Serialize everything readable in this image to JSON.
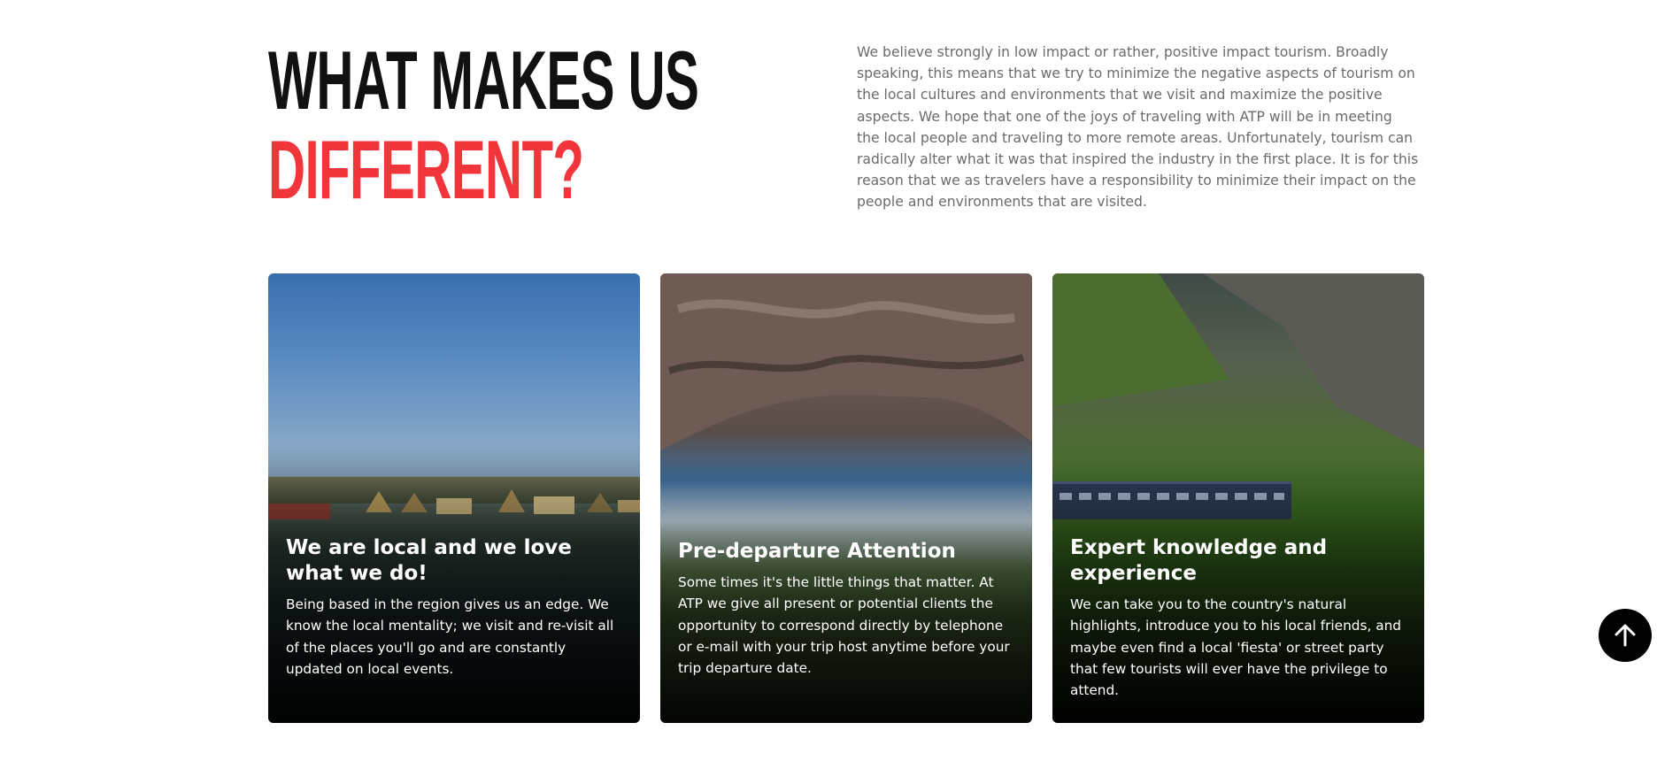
{
  "heading": {
    "line1": "WHAT MAKES US",
    "line2": "DIFFERENT?"
  },
  "intro": "We believe strongly in low impact or rather, positive impact tourism. Broadly speaking, this means that we try to minimize the negative aspects of tourism on the local cultures and environments that we visit and maximize the positive aspects. We hope that one of the joys of traveling with ATP will be in meeting the local people and traveling to more remote areas. Unfortunately, tourism can radically alter what it was that inspired the industry in the first place. It is for this reason that we as travelers have a responsibility to minimize their impact on the people and environments that are visited.",
  "cards": [
    {
      "title": "We are local and we love what we do!",
      "body": "Being based in the region gives us an edge. We know the local mentality; we visit and re-visit all of the places you'll go and are constantly updated on local events."
    },
    {
      "title": "Pre-departure Attention",
      "body": "Some times it's the little things that matter. At ATP we give all present or potential clients the opportunity to correspond directly by telephone or e-mail with your trip host anytime before your trip departure date."
    },
    {
      "title": "Expert knowledge and experience",
      "body": "We can take you to the country's natural highlights, introduce you to his local friends, and maybe even find a local 'fiesta' or street party that few tourists will ever have the privilege to attend."
    }
  ],
  "scroll_top": {
    "icon": "arrow-up-icon"
  },
  "colors": {
    "accent": "#f1353b",
    "heading": "#111111",
    "body_text": "#6b6b6b"
  }
}
